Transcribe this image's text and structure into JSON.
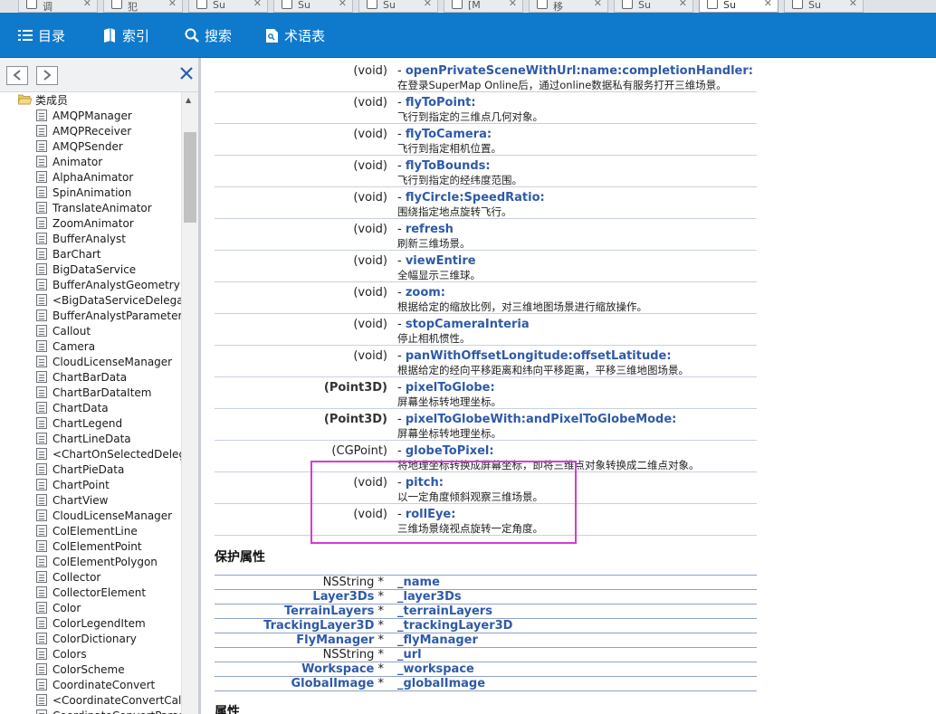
{
  "browser_tabs": [
    {
      "label": "调"
    },
    {
      "label": "犯"
    },
    {
      "label": "Su"
    },
    {
      "label": "Su"
    },
    {
      "label": "Su"
    },
    {
      "label": "[M"
    },
    {
      "label": "移"
    },
    {
      "label": "Su"
    },
    {
      "label": "Su",
      "active": true
    },
    {
      "label": "Su"
    }
  ],
  "toolbar": {
    "contents": "目录",
    "index": "索引",
    "search": "搜索",
    "glossary": "术语表"
  },
  "sidebar": {
    "root": "类成员",
    "items": [
      "AMQPManager",
      "AMQPReceiver",
      "AMQPSender",
      "Animator",
      "AlphaAnimator",
      "SpinAnimation",
      "TranslateAnimator",
      "ZoomAnimator",
      "BufferAnalyst",
      "BarChart",
      "BigDataService",
      "BufferAnalystGeometry",
      "<BigDataServiceDelegate",
      "BufferAnalystParameter",
      "Callout",
      "Camera",
      "CloudLicenseManager",
      "ChartBarData",
      "ChartBarDataItem",
      "ChartData",
      "ChartLegend",
      "ChartLineData",
      "<ChartOnSelectedDelega",
      "ChartPieData",
      "ChartPoint",
      "ChartView",
      "CloudLicenseManager",
      "ColElementLine",
      "ColElementPoint",
      "ColElementPolygon",
      "Collector",
      "CollectorElement",
      "Color",
      "ColorLegendItem",
      "ColorDictionary",
      "Colors",
      "ColorScheme",
      "CoordinateConvert",
      "<CoordinateConvertCallba",
      "CoordinateConvertParam"
    ]
  },
  "methods": [
    {
      "type": "(void)",
      "name": "openPrivateSceneWithUrl:name:completionHandler:",
      "desc": "在登录SuperMap Online后，通过online数据私有服务打开三维场景。"
    },
    {
      "type": "(void)",
      "name": "flyToPoint:",
      "desc": "飞行到指定的三维点几何对象。"
    },
    {
      "type": "(void)",
      "name": "flyToCamera:",
      "desc": "飞行到指定相机位置。"
    },
    {
      "type": "(void)",
      "name": "flyToBounds:",
      "desc": "飞行到指定的经纬度范围。"
    },
    {
      "type": "(void)",
      "name": "flyCircle:SpeedRatio:",
      "desc": "围绕指定地点旋转飞行。"
    },
    {
      "type": "(void)",
      "name": "refresh",
      "desc": "刷新三维场景。"
    },
    {
      "type": "(void)",
      "name": "viewEntire",
      "desc": "全幅显示三维球。"
    },
    {
      "type": "(void)",
      "name": "zoom:",
      "desc": "根据给定的缩放比例，对三维地图场景进行缩放操作。"
    },
    {
      "type": "(void)",
      "name": "stopCameraInteria",
      "desc": "停止相机惯性。"
    },
    {
      "type": "(void)",
      "name": "panWithOffsetLongitude:offsetLatitude:",
      "desc": "根据给定的经向平移距离和纬向平移距离，平移三维地图场景。"
    },
    {
      "type": "(Point3D)",
      "name": "pixelToGlobe:",
      "desc": "屏幕坐标转地理坐标。",
      "bold_type": true
    },
    {
      "type": "(Point3D)",
      "name": "pixelToGlobeWith:andPixelToGlobeMode:",
      "desc": "屏幕坐标转地理坐标。",
      "bold_type": true
    },
    {
      "type": "(CGPoint)",
      "name": "globeToPixel:",
      "desc": "将地理坐标转换成屏幕坐标，即将三维点对象转换成二维点对象。"
    },
    {
      "type": "(void)",
      "name": "pitch:",
      "desc": "以一定角度倾斜观察三维场景。"
    },
    {
      "type": "(void)",
      "name": "rollEye:",
      "desc": "三维场景绕视点旋转一定角度。"
    }
  ],
  "protected_title": "保护属性",
  "protected": [
    {
      "type": "NSString",
      "linked": false,
      "name": "_name"
    },
    {
      "type": "Layer3Ds",
      "linked": true,
      "name": "_layer3Ds"
    },
    {
      "type": "TerrainLayers",
      "linked": true,
      "name": "_terrainLayers"
    },
    {
      "type": "TrackingLayer3D",
      "linked": true,
      "name": "_trackingLayer3D"
    },
    {
      "type": "FlyManager",
      "linked": true,
      "name": "_flyManager"
    },
    {
      "type": "NSString",
      "linked": false,
      "name": "_url"
    },
    {
      "type": "Workspace",
      "linked": true,
      "name": "_workspace"
    },
    {
      "type": "GlobalImage",
      "linked": true,
      "name": "_globalImage"
    }
  ],
  "properties_title": "属性",
  "method_prefix": "- ",
  "pointer_suffix": " *",
  "colors": {
    "toolbar": "#0f7acc",
    "link": "#2e5aa8",
    "highlight": "#d63ad6"
  }
}
